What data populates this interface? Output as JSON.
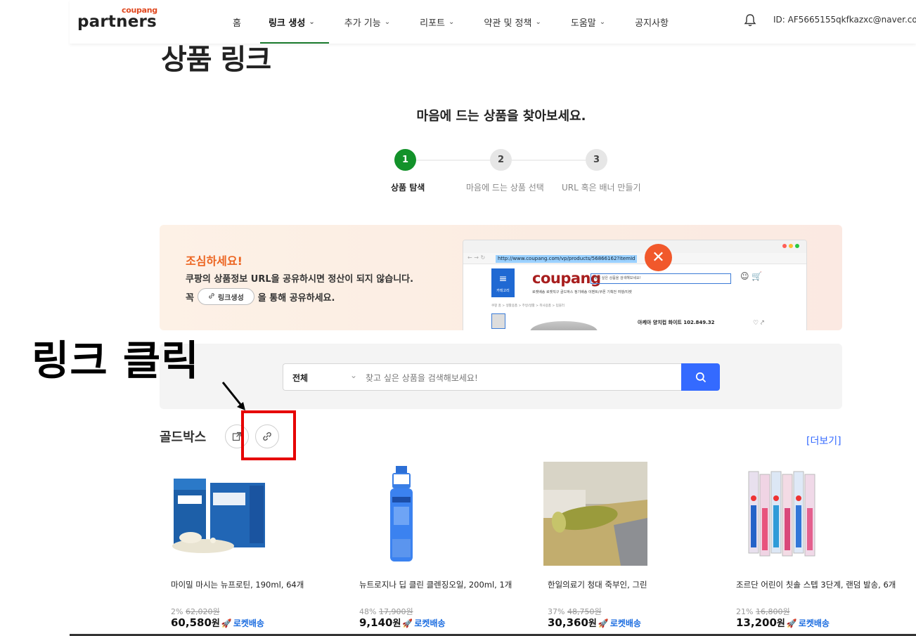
{
  "header": {
    "logo_small": "coupang",
    "logo_big": "partners",
    "nav": [
      {
        "label": "홈",
        "dropdown": false
      },
      {
        "label": "링크 생성",
        "dropdown": true,
        "active": true
      },
      {
        "label": "추가 기능",
        "dropdown": true
      },
      {
        "label": "리포트",
        "dropdown": true
      },
      {
        "label": "약관 및 정책",
        "dropdown": true
      },
      {
        "label": "도움말",
        "dropdown": true
      },
      {
        "label": "공지사항",
        "dropdown": false
      }
    ],
    "user_id": "ID: AF5665155",
    "user_email": "qkfkazxc@naver.com"
  },
  "page_title": "상품 링크",
  "subtitle": "마음에 드는 상품을 찾아보세요.",
  "steps": [
    {
      "num": "1",
      "label": "상품 탐색",
      "active": true
    },
    {
      "num": "2",
      "label": "마음에 드는 상품 선택",
      "active": false
    },
    {
      "num": "3",
      "label": "URL 혹은 배너 만들기",
      "active": false
    }
  ],
  "banner": {
    "title": "조심하세요!",
    "line1": "쿠팡의 상품정보 URL을 공유하시면 정산이 되지 않습니다.",
    "line2_prefix": "꼭",
    "pill_label": "링크생성",
    "line2_suffix": "을 통해 공유하세요.",
    "mock": {
      "url": "http://www.coupang.com/vp/products/56866162?itemId",
      "menu_label": "카테고리",
      "logo": "coupang",
      "search_text": "찾고 싶은 상품을 검색해보세요!",
      "sub_nav": "로켓배송   로켓직구   골드박스   정기배송   이벤트/쿠폰   기획전   여행/티켓",
      "crumb": "쿠팡 홈  >  생활용품  >  주방/생활  >  취사용품  >  텀블러",
      "product": "아케아 양치컵 화이트 102.849.32",
      "dot_colors": [
        "#ff5f57",
        "#febc2e",
        "#28c840"
      ]
    }
  },
  "search": {
    "category": "전체",
    "placeholder": "찾고 싶은 상품을 검색해보세요!"
  },
  "annotation": {
    "text": "링크 클릭"
  },
  "section": {
    "title": "골드박스",
    "more": "[더보기]"
  },
  "products": [
    {
      "name": "마이밀 마시는 뉴프로틴, 190ml, 64개",
      "discount": "2%",
      "original": "62,020원",
      "price": "60,580",
      "won": "원",
      "badge": "로켓배송",
      "image": "protein-drink"
    },
    {
      "name": "뉴트로지나 딥 클린 클렌징오일, 200ml, 1개",
      "discount": "48%",
      "original": "17,900원",
      "price": "9,140",
      "won": "원",
      "badge": "로켓배송",
      "image": "cleansing-oil"
    },
    {
      "name": "한일의료기 청대 죽부인, 그린",
      "discount": "37%",
      "original": "48,750원",
      "price": "30,360",
      "won": "원",
      "badge": "로켓배송",
      "image": "bamboo-pillow"
    },
    {
      "name": "조르단 어린이 칫솔 스텝 3단계, 랜덤 발송, 6개",
      "discount": "21%",
      "original": "16,800원",
      "price": "13,200",
      "won": "원",
      "badge": "로켓배송",
      "image": "toothbrush"
    }
  ],
  "colors": {
    "brand_green": "#13922a",
    "accent_blue": "#346aff",
    "warning_orange": "#ec6420",
    "annotation_red": "#e60000"
  }
}
